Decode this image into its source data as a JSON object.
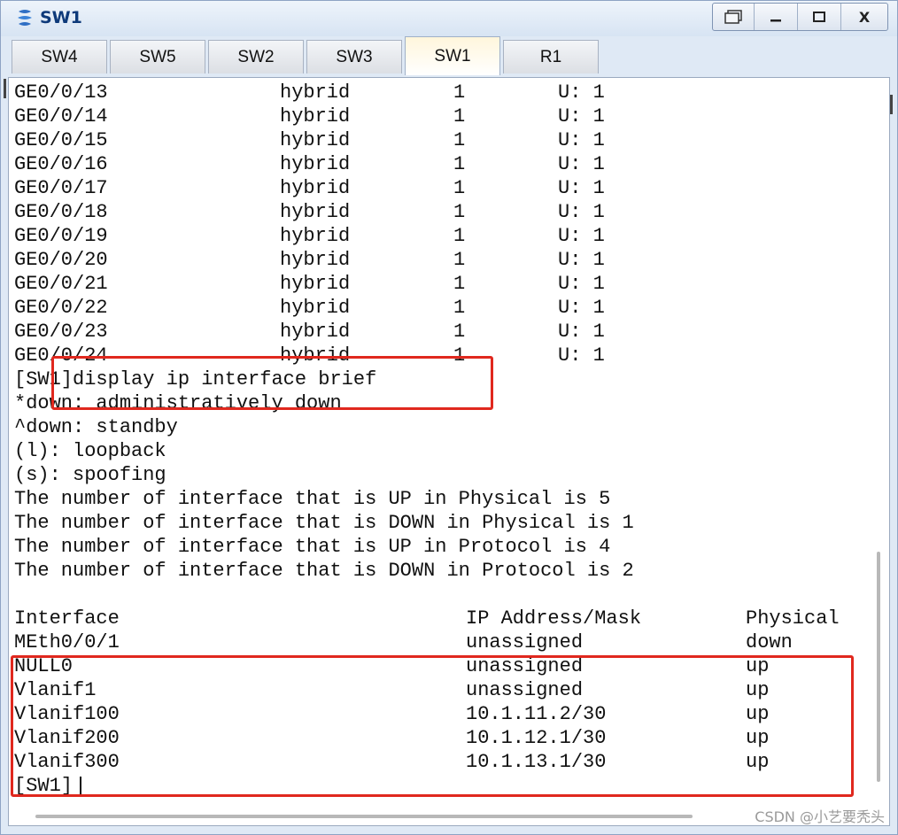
{
  "window": {
    "title": "SW1",
    "controls": [
      "restore",
      "minimize",
      "maximize",
      "close"
    ],
    "close_label": "X"
  },
  "tabs": [
    "SW4",
    "SW5",
    "SW2",
    "SW3",
    "SW1",
    "R1"
  ],
  "active_tab": "SW1",
  "port_rows": [
    [
      "GE0/0/13",
      "hybrid",
      "1",
      "U: 1"
    ],
    [
      "GE0/0/14",
      "hybrid",
      "1",
      "U: 1"
    ],
    [
      "GE0/0/15",
      "hybrid",
      "1",
      "U: 1"
    ],
    [
      "GE0/0/16",
      "hybrid",
      "1",
      "U: 1"
    ],
    [
      "GE0/0/17",
      "hybrid",
      "1",
      "U: 1"
    ],
    [
      "GE0/0/18",
      "hybrid",
      "1",
      "U: 1"
    ],
    [
      "GE0/0/19",
      "hybrid",
      "1",
      "U: 1"
    ],
    [
      "GE0/0/20",
      "hybrid",
      "1",
      "U: 1"
    ],
    [
      "GE0/0/21",
      "hybrid",
      "1",
      "U: 1"
    ],
    [
      "GE0/0/22",
      "hybrid",
      "1",
      "U: 1"
    ],
    [
      "GE0/0/23",
      "hybrid",
      "1",
      "U: 1"
    ],
    [
      "GE0/0/24",
      "hybrid",
      "1",
      "U: 1"
    ]
  ],
  "command": "[SW1]display ip interface brief",
  "info_lines": [
    "*down: administratively down",
    "^down: standby",
    "(l): loopback",
    "(s): spoofing",
    "The number of interface that is UP in Physical is 5",
    "The number of interface that is DOWN in Physical is 1",
    "The number of interface that is UP in Protocol is 4",
    "The number of interface that is DOWN in Protocol is 2"
  ],
  "ip_table": {
    "headers": [
      "Interface",
      "IP Address/Mask",
      "Physical"
    ],
    "rows": [
      [
        "MEth0/0/1",
        "unassigned",
        "down"
      ],
      [
        "NULL0",
        "unassigned",
        "up"
      ],
      [
        "Vlanif1",
        "unassigned",
        "up"
      ],
      [
        "Vlanif100",
        "10.1.11.2/30",
        "up"
      ],
      [
        "Vlanif200",
        "10.1.12.1/30",
        "up"
      ],
      [
        "Vlanif300",
        "10.1.13.1/30",
        "up"
      ]
    ]
  },
  "prompt": "[SW1]",
  "highlight_color": "#e0281e",
  "watermark": "CSDN @小艺要秃头"
}
